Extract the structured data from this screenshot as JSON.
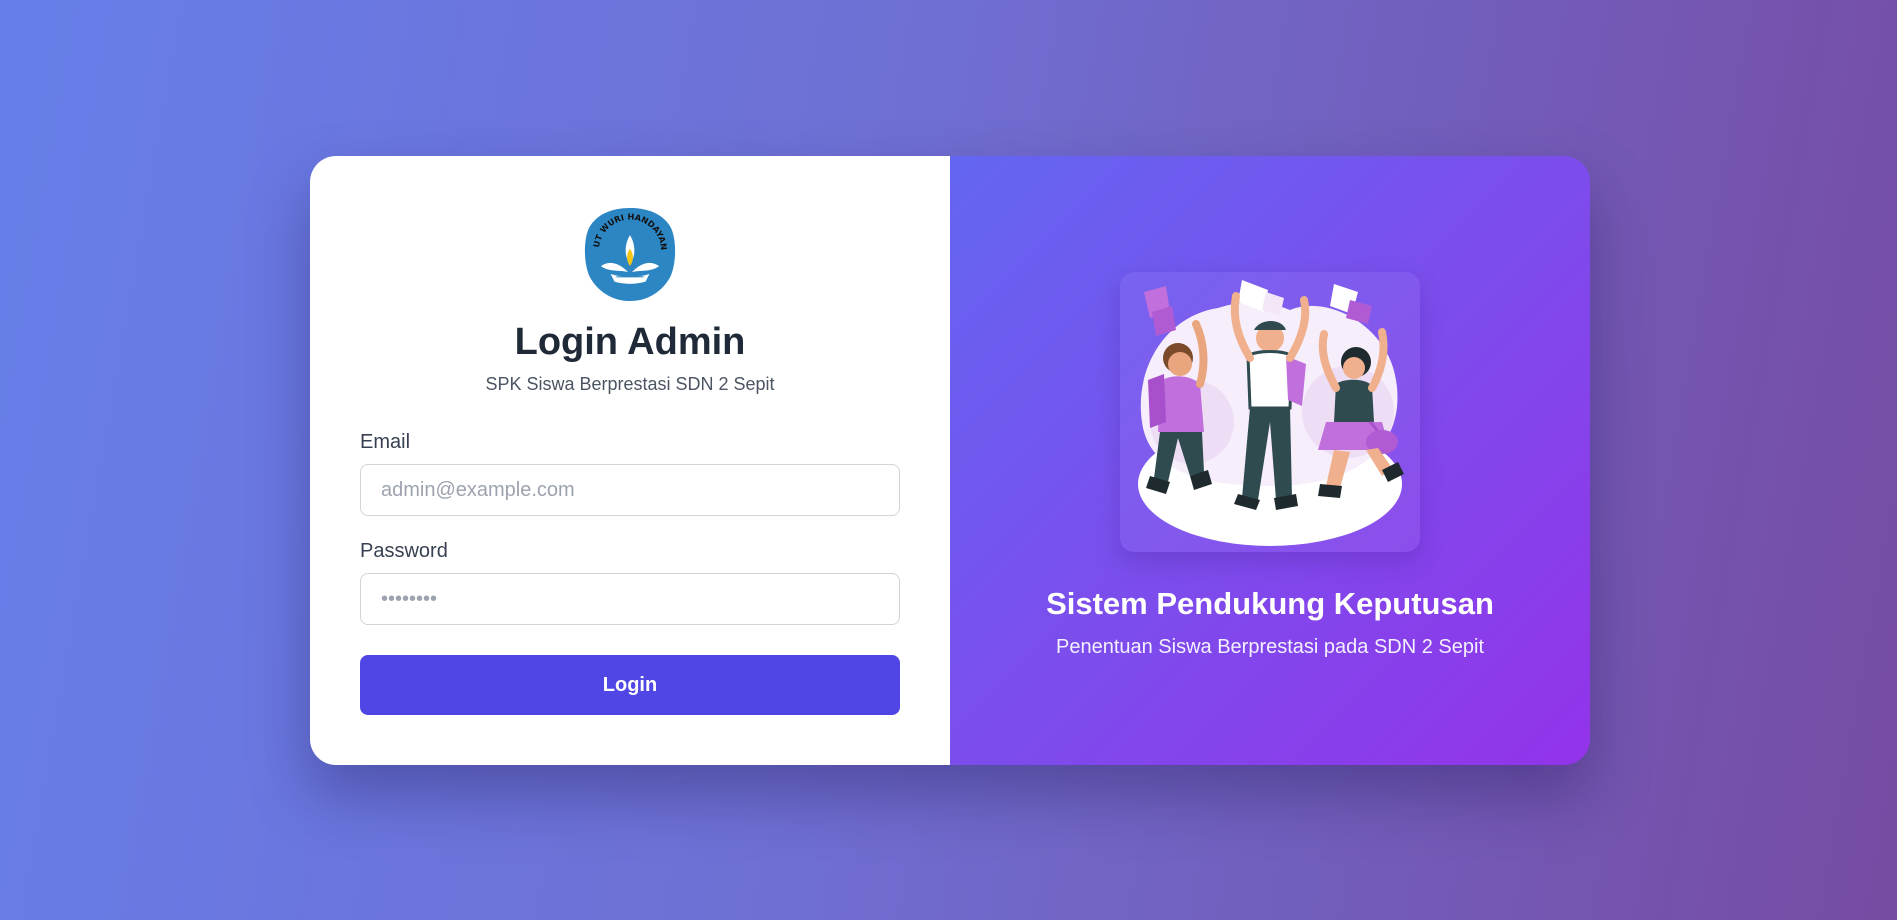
{
  "login": {
    "title": "Login Admin",
    "subtitle": "SPK Siswa Berprestasi SDN 2 Sepit",
    "email_label": "Email",
    "email_placeholder": "admin@example.com",
    "password_label": "Password",
    "password_placeholder": "••••••••",
    "submit_label": "Login",
    "logo_text": "TUT WURI HANDAYANI"
  },
  "hero": {
    "title": "Sistem Pendukung Keputusan",
    "subtitle": "Penentuan Siswa Berprestasi pada SDN 2 Sepit"
  },
  "colors": {
    "accent": "#4f46e5",
    "bg_gradient_start": "#667eea",
    "bg_gradient_end": "#764ba2",
    "hero_gradient_start": "#6366f1",
    "hero_gradient_end": "#9333ea"
  }
}
